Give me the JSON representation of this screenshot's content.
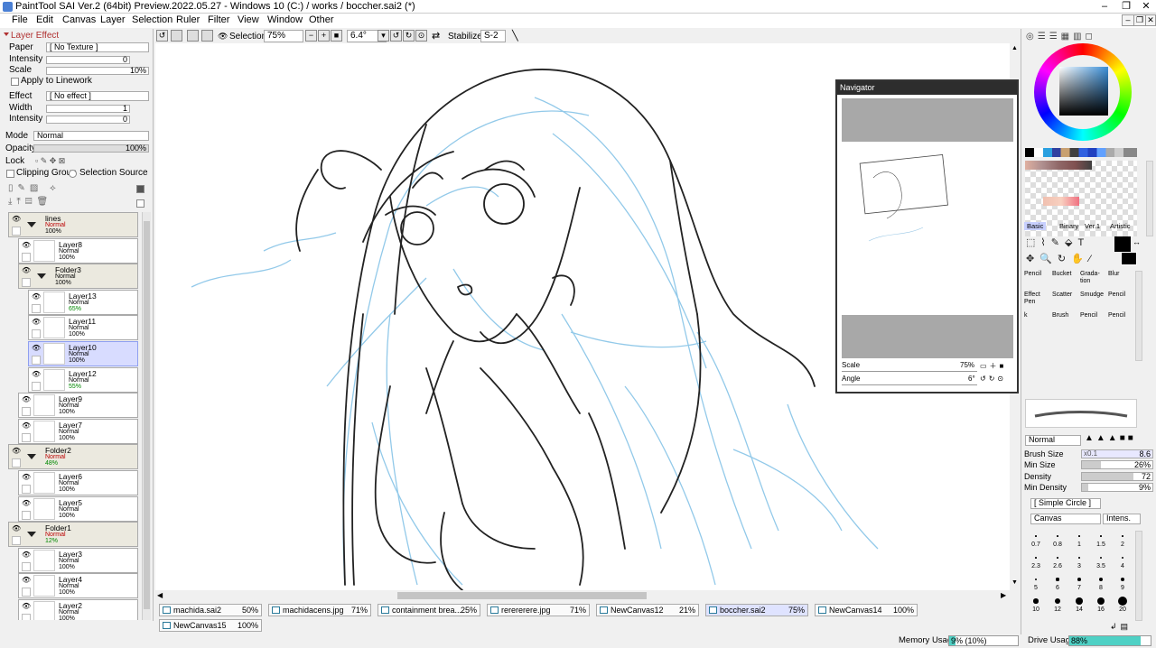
{
  "window": {
    "title": "PaintTool SAI Ver.2 (64bit) Preview.2022.05.27 - Windows 10 (C:) / works / boccher.sai2 (*)"
  },
  "menu": [
    "File",
    "Edit",
    "Canvas",
    "Layer",
    "Selection",
    "Ruler",
    "Filter",
    "View",
    "Window",
    "Other"
  ],
  "toolbar": {
    "selection_label": "Selection",
    "zoom": "75%",
    "angle": "6.4°",
    "stabilizer_label": "Stabilizer",
    "stabilizer_value": "S-2"
  },
  "layer_effect": {
    "header": "Layer Effect",
    "paper_label": "Paper",
    "paper_value": "[ No Texture ]",
    "intensity_label": "Intensity",
    "intensity_value": "0",
    "scale_label": "Scale",
    "scale_value": "10%",
    "apply_linework": "Apply to Linework",
    "effect_label": "Effect",
    "effect_value": "[ No effect ]",
    "width_label": "Width",
    "width_value": "1",
    "intensity2_label": "Intensity",
    "intensity2_value": "0"
  },
  "layer_props": {
    "mode_label": "Mode",
    "mode_value": "Normal",
    "opacity_label": "Opacity",
    "opacity_value": "100%",
    "lock_label": "Lock",
    "clipping_group": "Clipping Group",
    "selection_source": "Selection Source"
  },
  "layers": [
    {
      "name": "lines",
      "mode": "Normal",
      "opacity": "100%",
      "folder": true,
      "indent": 0,
      "red": true
    },
    {
      "name": "Layer8",
      "mode": "Normal",
      "opacity": "100%",
      "folder": false,
      "indent": 1
    },
    {
      "name": "Folder3",
      "mode": "Normal",
      "opacity": "100%",
      "folder": true,
      "indent": 1
    },
    {
      "name": "Layer13",
      "mode": "Normal",
      "opacity": "65%",
      "folder": false,
      "indent": 2,
      "green": true
    },
    {
      "name": "Layer11",
      "mode": "Normal",
      "opacity": "100%",
      "folder": false,
      "indent": 2
    },
    {
      "name": "Layer10",
      "mode": "Normal",
      "opacity": "100%",
      "folder": false,
      "indent": 2,
      "selected": true
    },
    {
      "name": "Layer12",
      "mode": "Normal",
      "opacity": "55%",
      "folder": false,
      "indent": 2,
      "green": true
    },
    {
      "name": "Layer9",
      "mode": "Normal",
      "opacity": "100%",
      "folder": false,
      "indent": 1
    },
    {
      "name": "Layer7",
      "mode": "Normal",
      "opacity": "100%",
      "folder": false,
      "indent": 1
    },
    {
      "name": "Folder2",
      "mode": "Normal",
      "opacity": "48%",
      "folder": true,
      "indent": 0,
      "red": true,
      "green": true
    },
    {
      "name": "Layer6",
      "mode": "Normal",
      "opacity": "100%",
      "folder": false,
      "indent": 1
    },
    {
      "name": "Layer5",
      "mode": "Normal",
      "opacity": "100%",
      "folder": false,
      "indent": 1
    },
    {
      "name": "Folder1",
      "mode": "Normal",
      "opacity": "12%",
      "folder": true,
      "indent": 0,
      "red": true,
      "green": true
    },
    {
      "name": "Layer3",
      "mode": "Normal",
      "opacity": "100%",
      "folder": false,
      "indent": 1
    },
    {
      "name": "Layer4",
      "mode": "Normal",
      "opacity": "100%",
      "folder": false,
      "indent": 1
    },
    {
      "name": "Layer2",
      "mode": "Normal",
      "opacity": "100%",
      "folder": false,
      "indent": 1
    }
  ],
  "navigator": {
    "title": "Navigator",
    "scale_label": "Scale",
    "scale_value": "75%",
    "angle_label": "Angle",
    "angle_value": "6°"
  },
  "tabs_row1": [
    {
      "name": "machida.sai2",
      "pct": "50%"
    },
    {
      "name": "machidacens.jpg",
      "pct": "71%"
    },
    {
      "name": "containment brea...",
      "pct": "25%"
    },
    {
      "name": "rerererere.jpg",
      "pct": "71%"
    },
    {
      "name": "NewCanvas12",
      "pct": "21%"
    },
    {
      "name": "boccher.sai2",
      "pct": "75%",
      "active": true
    },
    {
      "name": "NewCanvas14",
      "pct": "100%"
    }
  ],
  "tabs_row2": [
    {
      "name": "NewCanvas15",
      "pct": "100%"
    }
  ],
  "brush_tabs": [
    "Basic",
    "Binary",
    "Ver.1",
    "Artistic"
  ],
  "tools": [
    [
      "Pencil",
      "Bucket",
      "Grada-\ntion",
      "Blur"
    ],
    [
      "Effect\nPen",
      "Scatter",
      "Smudge",
      "Pencil"
    ],
    [
      "k",
      "Brush",
      "Pencil",
      "Pencil"
    ]
  ],
  "brush": {
    "mode": "Normal",
    "size_label": "Brush Size",
    "size_mult": "x0.1",
    "size_value": "8.6",
    "min_size_label": "Min Size",
    "min_size_value": "26%",
    "density_label": "Density",
    "density_value": "72",
    "min_density_label": "Min Density",
    "min_density_value": "9%",
    "shape": "[ Simple Circle ]",
    "texture": "Canvas",
    "texture_intensity": "Intens."
  },
  "brush_sizes": [
    [
      "0.7",
      "0.8",
      "1",
      "1.5",
      "2"
    ],
    [
      "2.3",
      "2.6",
      "3",
      "3.5",
      "4"
    ],
    [
      "5",
      "6",
      "7",
      "8",
      "9"
    ],
    [
      "10",
      "12",
      "14",
      "16",
      "20"
    ]
  ],
  "status": {
    "memory_label": "Memory Usage",
    "memory_value": "9% (10%)",
    "memory_fraction": 0.09,
    "drive_label": "Drive Usage",
    "drive_value": "88%",
    "drive_fraction": 0.88
  },
  "colors": {
    "accent": "#4fd1c5",
    "selected_layer": "#d8dcff",
    "folder_bg": "#ebe9df",
    "sketch_blue": "#7fc0e6"
  }
}
